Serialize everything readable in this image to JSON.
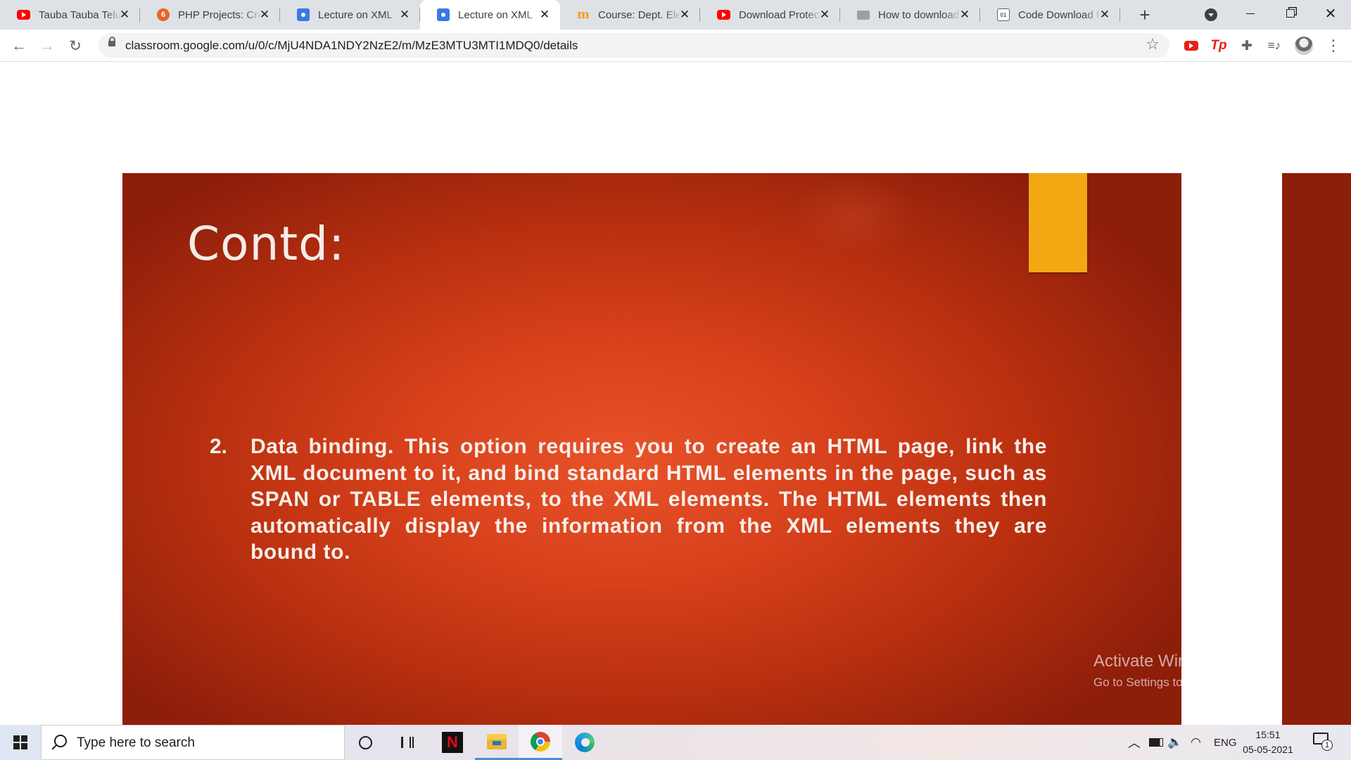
{
  "browser": {
    "tabs": [
      {
        "favicon": "youtube-icon",
        "title": "Tauba Tauba Telugu",
        "active": false
      },
      {
        "favicon": "php-icon",
        "title": "PHP Projects: Create",
        "active": false
      },
      {
        "favicon": "google-classroom-icon",
        "title": "Lecture on XML",
        "active": false
      },
      {
        "favicon": "google-classroom-icon",
        "title": "Lecture on XML",
        "active": true
      },
      {
        "favicon": "moodle-icon",
        "title": "Course: Dept. Electronics",
        "active": false
      },
      {
        "favicon": "youtube-icon",
        "title": "Download Protected",
        "active": false
      },
      {
        "favicon": "image-icon",
        "title": "How to download",
        "active": false
      },
      {
        "favicon": "code-icon",
        "title": "Code Download f",
        "active": false
      }
    ],
    "close_glyph": "✕",
    "new_tab_glyph": "+",
    "url": "classroom.google.com/u/0/c/MjU4NDA1NDY2NzE2/m/MzE3MTU3MTI1MDQ0/details",
    "extension_tp_label": "Tp"
  },
  "slide": {
    "title": "Contd:",
    "item_number": "2.",
    "item_text": "Data binding. This option requires you to create an HTML page, link the XML document to it, and bind standard HTML elements in the page, such as SPAN or TABLE elements, to the XML elements. The HTML elements then automatically display the information from the XML elements they are bound to.",
    "background_color": "#d6401b",
    "accent_color": "#f3a712"
  },
  "watermark": {
    "title": "Activate Windows",
    "subtitle": "Go to Settings to activate Windows."
  },
  "taskbar": {
    "search_placeholder": "Type here to search",
    "netflix_label": "N",
    "language": "ENG",
    "time": "15:51",
    "date": "05-05-2021",
    "notification_count": "1"
  }
}
